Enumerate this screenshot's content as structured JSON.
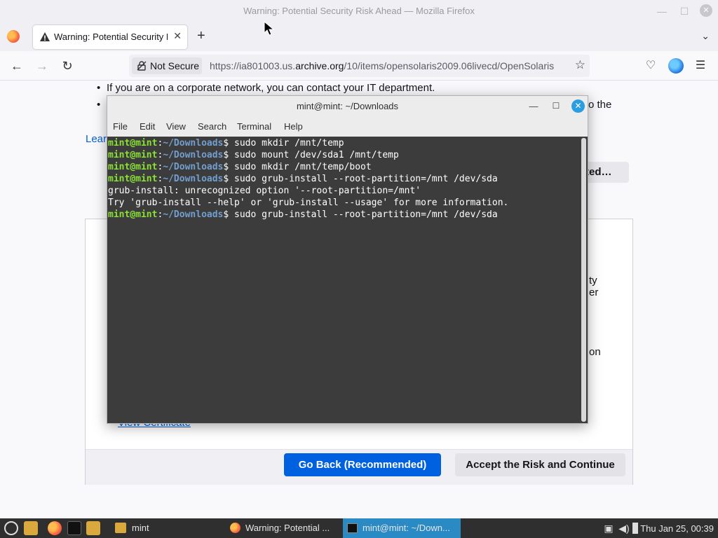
{
  "window": {
    "title": "Warning: Potential Security Risk Ahead — Mozilla Firefox",
    "minimize": "—",
    "maximize": "☐",
    "close": "✕"
  },
  "tabs": {
    "active_title": "Warning: Potential Security Risk Ahead",
    "close": "✕",
    "new_tab": "+",
    "list": "⌄"
  },
  "nav": {
    "back": "←",
    "forward": "→",
    "reload": "↻",
    "not_secure": "Not Secure",
    "url_prefix": "https://ia801003.us.",
    "url_domain": "archive.org",
    "url_suffix": "/10/items/opensolaris2009.06livecd/OpenSolaris",
    "bookmark": "☆",
    "pocket": "♡",
    "menu": "☰"
  },
  "page": {
    "bullet1": "If you are on a corporate network, you can contact your IT department.",
    "bullet2_tail": "o the",
    "learn_more": "Lear",
    "advanced": "ted…",
    "frag1": "ty",
    "frag2": "er",
    "frag3": "on",
    "view_certificate": "View Certificate",
    "go_back": "Go Back (Recommended)",
    "accept": "Accept the Risk and Continue"
  },
  "terminal": {
    "title": "mint@mint: ~/Downloads",
    "minimize": "—",
    "maximize": "☐",
    "close": "✕",
    "menu": [
      "File",
      "Edit",
      "View",
      "Search",
      "Terminal",
      "Help"
    ],
    "prompt_user": "mint@mint",
    "prompt_path": "~/Downloads",
    "lines": [
      {
        "type": "cmd",
        "text": " sudo mkdir /mnt/temp"
      },
      {
        "type": "cmd",
        "text": " sudo mount /dev/sda1 /mnt/temp"
      },
      {
        "type": "cmd",
        "text": " sudo mkdir /mnt/temp/boot"
      },
      {
        "type": "cmd",
        "text": " sudo grub-install --root-partition=/mnt /dev/sda"
      },
      {
        "type": "out",
        "text": "grub-install: unrecognized option '--root-partition=/mnt'"
      },
      {
        "type": "out",
        "text": "Try 'grub-install --help' or 'grub-install --usage' for more information."
      },
      {
        "type": "cmd",
        "text": " sudo grub-install --root-partition=/mnt /dev/sda"
      }
    ]
  },
  "taskbar": {
    "folder_label": "mint",
    "task_firefox": "Warning: Potential ...",
    "task_terminal": "mint@mint: ~/Down...",
    "clock": "Thu Jan 25, 00:39"
  }
}
